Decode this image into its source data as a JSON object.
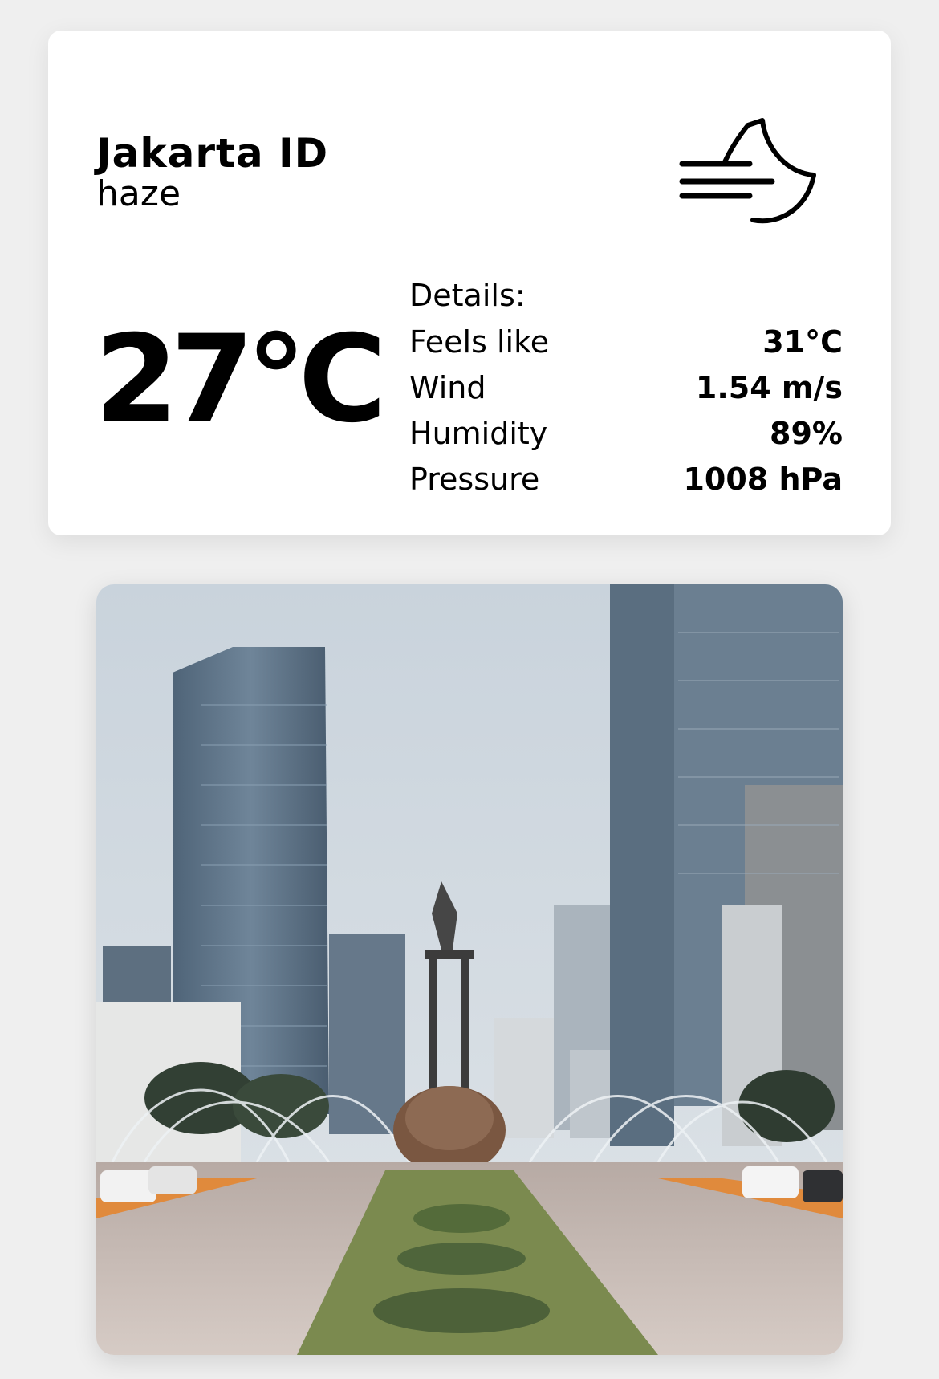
{
  "location": {
    "city": "Jakarta ID",
    "description": "haze"
  },
  "weather_icon": "haze-night-icon",
  "current": {
    "temperature": "27°C"
  },
  "details": {
    "title": "Details:",
    "rows": [
      {
        "label": "Feels like",
        "value": "31°C"
      },
      {
        "label": "Wind",
        "value": "1.54 m/s"
      },
      {
        "label": "Humidity",
        "value": "89%"
      },
      {
        "label": "Pressure",
        "value": "1008 hPa"
      }
    ]
  },
  "photo": {
    "subject": "city-photo"
  }
}
